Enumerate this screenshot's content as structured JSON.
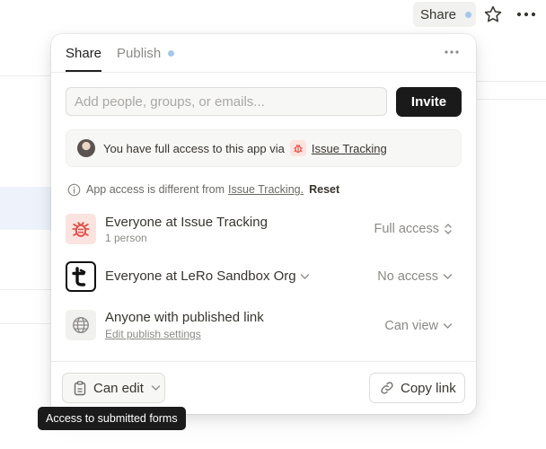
{
  "topbar": {
    "share_label": "Share"
  },
  "popover": {
    "tabs": [
      {
        "label": "Share"
      },
      {
        "label": "Publish"
      }
    ],
    "invite": {
      "placeholder": "Add people, groups, or emails...",
      "button_label": "Invite"
    },
    "access_banner": {
      "text": "You have full access to this app via",
      "link": "Issue Tracking"
    },
    "notice": {
      "text": "App access is different from",
      "link": "Issue Tracking.",
      "reset_label": "Reset"
    },
    "members": [
      {
        "title": "Everyone at Issue Tracking",
        "subtitle": "1 person",
        "permission": "Full access",
        "icon": "bug-icon"
      },
      {
        "title": "Everyone at LeRo Sandbox Org",
        "permission": "No access",
        "icon": "workspace-t-icon"
      },
      {
        "title": "Anyone with published link",
        "subtitle": "Edit publish settings",
        "permission": "Can view",
        "icon": "globe-icon"
      }
    ],
    "footer": {
      "can_edit_label": "Can edit",
      "copy_link_label": "Copy link"
    }
  },
  "tooltip": {
    "text": "Access to submitted forms"
  },
  "colors": {
    "accent_dot": "#a4c7ea",
    "primary_button": "#1a1a1a",
    "bug_red": "#e0524a",
    "bug_bg": "#fbe3e0"
  }
}
